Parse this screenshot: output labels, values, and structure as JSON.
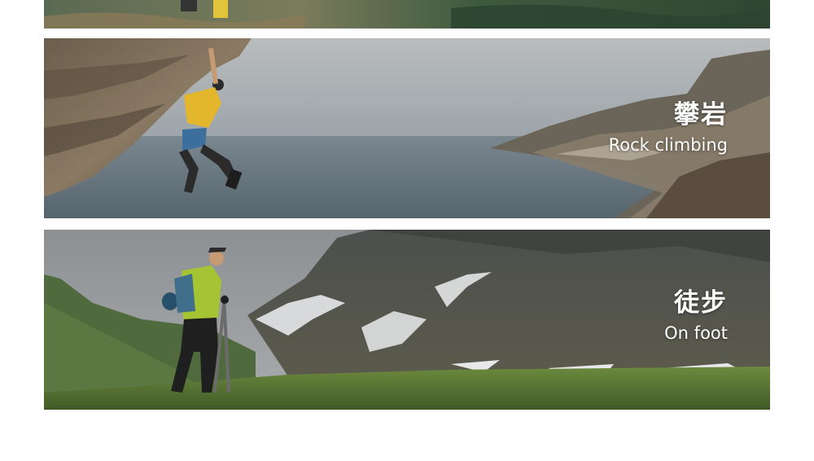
{
  "sections": [
    {
      "id": "top-partial"
    },
    {
      "id": "rock-climbing",
      "title_cn": "攀岩",
      "title_en": "Rock climbing"
    },
    {
      "id": "on-foot",
      "title_cn": "徒步",
      "title_en": "On foot"
    }
  ],
  "colors": {
    "background": "#ffffff",
    "caption_text": "#ffffff"
  }
}
